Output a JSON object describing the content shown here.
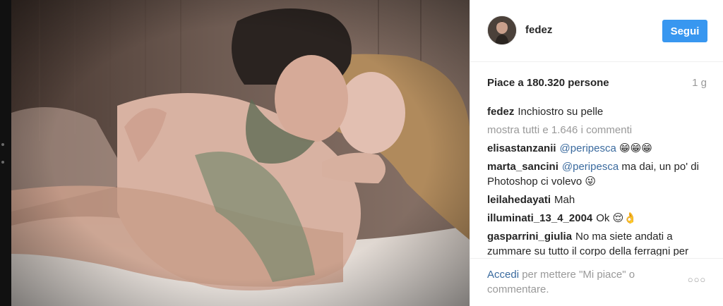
{
  "post": {
    "username": "fedez",
    "follow_label": "Segui",
    "likes": "Piace a 180.320 persone",
    "time": "1 g",
    "caption_user": "fedez",
    "caption_text": "Inchiostro su pelle",
    "view_all_comments": "mostra tutti e 1.646 i commenti"
  },
  "comments": [
    {
      "user": "elisastanzanii",
      "mention": "@peripesca",
      "text": "😁😁😁"
    },
    {
      "user": "marta_sancini",
      "mention": "@peripesca",
      "text": "ma dai, un po' di Photoshop ci volevo 😜"
    },
    {
      "user": "leilahedayati",
      "mention": "",
      "text": "Mah"
    },
    {
      "user": "illuminati_13_4_2004",
      "mention": "",
      "text": "Ok 😌👌"
    },
    {
      "user": "gasparrini_giulia",
      "mention": "",
      "text": "No ma siete andati a zummare su tutto il corpo della ferragni per"
    }
  ],
  "footer": {
    "login_link": "Accedi",
    "login_rest": " per mettere \"Mi piace\" o commentare.",
    "more_options_icon": "ellipsis-icon"
  },
  "colors": {
    "accent": "#3897f0",
    "link": "#3a6a9e",
    "muted": "#999999",
    "text": "#262626"
  }
}
